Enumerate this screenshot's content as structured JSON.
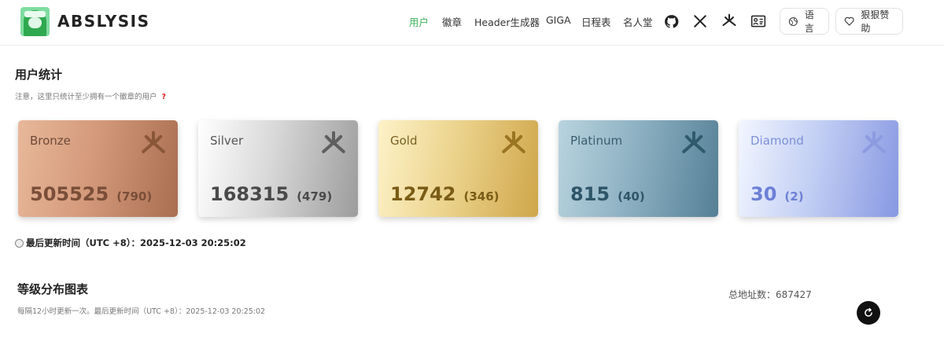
{
  "header": {
    "brand": "ABSLYSIS",
    "nav": [
      {
        "label": "用户",
        "active": true
      },
      {
        "label": "徽章",
        "active": false
      },
      {
        "label": "Header生成器",
        "active": false
      },
      {
        "label": "GIGA",
        "active": false
      },
      {
        "label": "日程表",
        "active": false
      },
      {
        "label": "名人堂",
        "active": false
      }
    ],
    "icons": [
      "github-icon",
      "x-icon",
      "abstract-icon",
      "id-card-icon"
    ],
    "language_label": "语言",
    "donate_label": "狠狠赞助",
    "accent_color": "#3fb25d"
  },
  "stats": {
    "title": "用户统计",
    "note": "注意，这里只统计至少拥有一个徽章的用户",
    "note_help": "?",
    "tiers": [
      {
        "name": "Bronze",
        "count": "505525",
        "sub": "(790)",
        "text_color": "#7a4e38"
      },
      {
        "name": "Silver",
        "count": "168315",
        "sub": "(479)",
        "text_color": "#4a4a4a"
      },
      {
        "name": "Gold",
        "count": "12742",
        "sub": "(346)",
        "text_color": "#7a5c16"
      },
      {
        "name": "Platinum",
        "count": "815",
        "sub": "(40)",
        "text_color": "#2f5668"
      },
      {
        "name": "Diamond",
        "count": "30",
        "sub": "(2)",
        "text_color": "#6c7fd6"
      }
    ],
    "updated": "最后更新时间（UTC +8）：2025-12-03 20:25:02"
  },
  "distribution": {
    "title": "等级分布图表",
    "note": "每隔12小时更新一次。最后更新时间（UTC +8）：2025-12-03 20:25:02",
    "total": "总地址数：687427"
  }
}
